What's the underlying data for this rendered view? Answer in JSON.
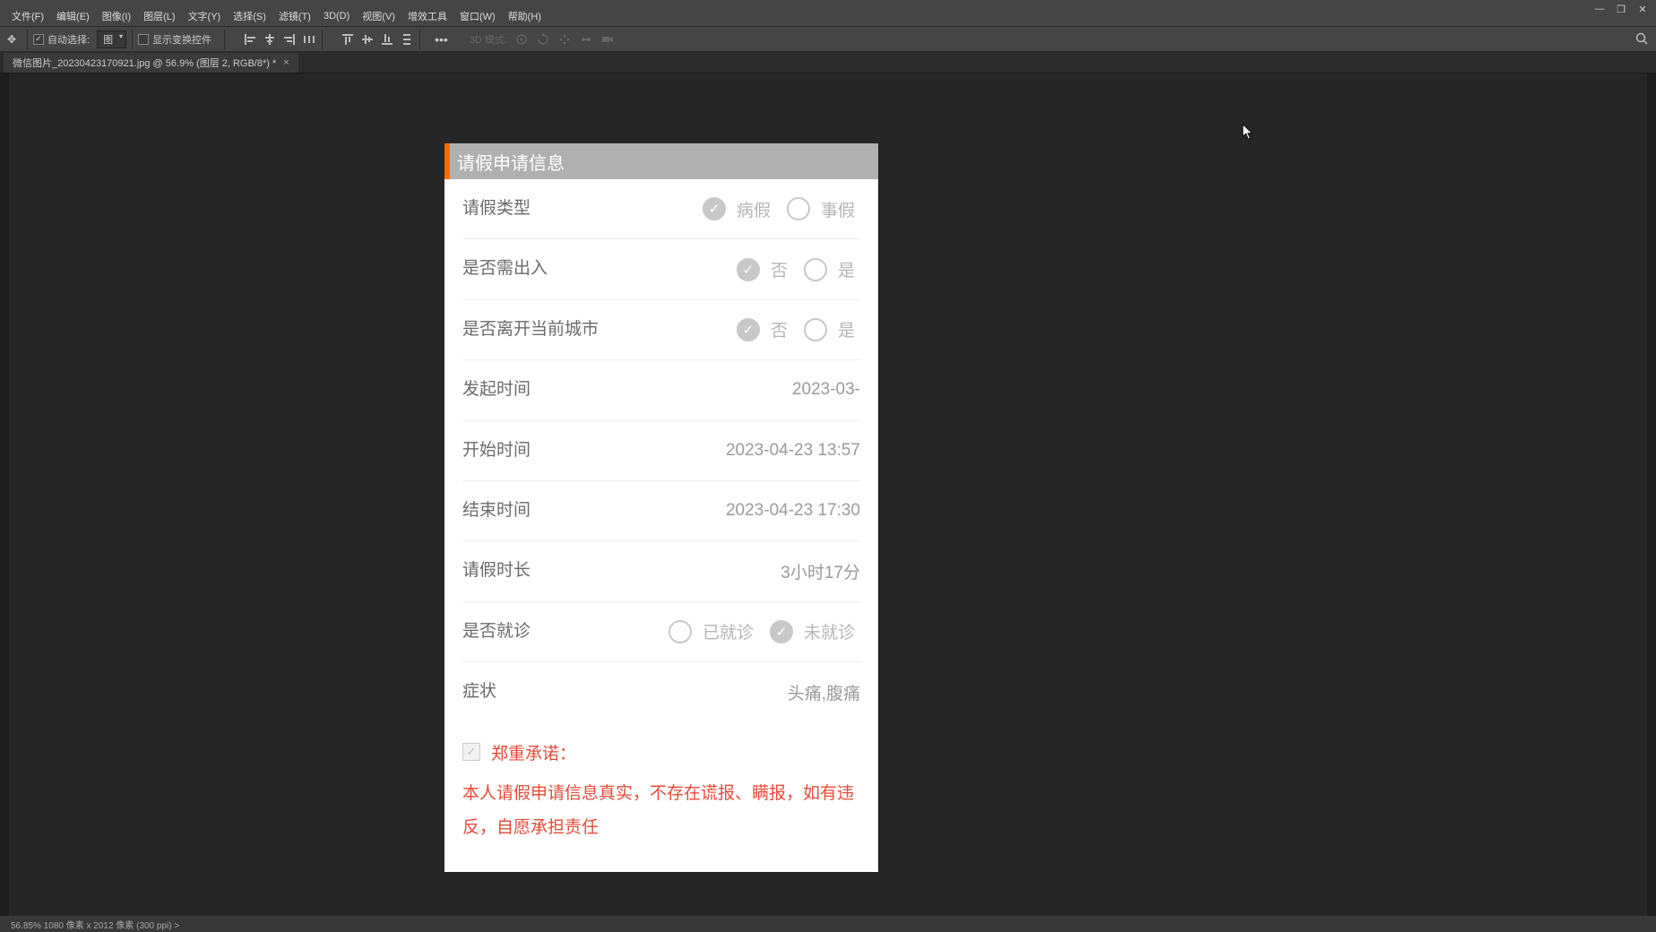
{
  "menubar": {
    "file": "文件(F)",
    "edit": "编辑(E)",
    "image": "图像(I)",
    "layer": "图层(L)",
    "type": "文字(Y)",
    "select": "选择(S)",
    "filter": "滤镜(T)",
    "threed": "3D(D)",
    "view": "视图(V)",
    "plugins": "增效工具",
    "window": "窗口(W)",
    "help": "帮助(H)"
  },
  "optbar": {
    "autoselect": "自动选择:",
    "layer_sel": "图",
    "show_transform": "显示变换控件",
    "mode3d": "3D 模式:"
  },
  "doctab": {
    "name": "微信图片_20230423170921.jpg @ 56.9% (图层 2, RGB/8*) *"
  },
  "form": {
    "header": "请假申请信息",
    "rows": {
      "leave_type": {
        "label": "请假类型",
        "opt1": "病假",
        "opt2": "事假"
      },
      "need_inout": {
        "label": "是否需出入",
        "opt1": "否",
        "opt2": "是"
      },
      "leave_city": {
        "label": "是否离开当前城市",
        "opt1": "否",
        "opt2": "是"
      },
      "initiate_time": {
        "label": "发起时间",
        "value": "2023-03-"
      },
      "start_time": {
        "label": "开始时间",
        "value": "2023-04-23 13:57"
      },
      "end_time": {
        "label": "结束时间",
        "value": "2023-04-23 17:30"
      },
      "duration": {
        "label": "请假时长",
        "value": "3小时17分"
      },
      "visited": {
        "label": "是否就诊",
        "opt1": "已就诊",
        "opt2": "未就诊"
      },
      "symptom": {
        "label": "症状",
        "value": "头痛,腹痛"
      }
    },
    "commit": {
      "title": "郑重承诺：",
      "body": "本人请假申请信息真实，不存在谎报、瞒报，如有违反，自愿承担责任"
    }
  },
  "statusbar": "56.85%   1080 像素 x 2012 像素 (300 ppi)   >"
}
